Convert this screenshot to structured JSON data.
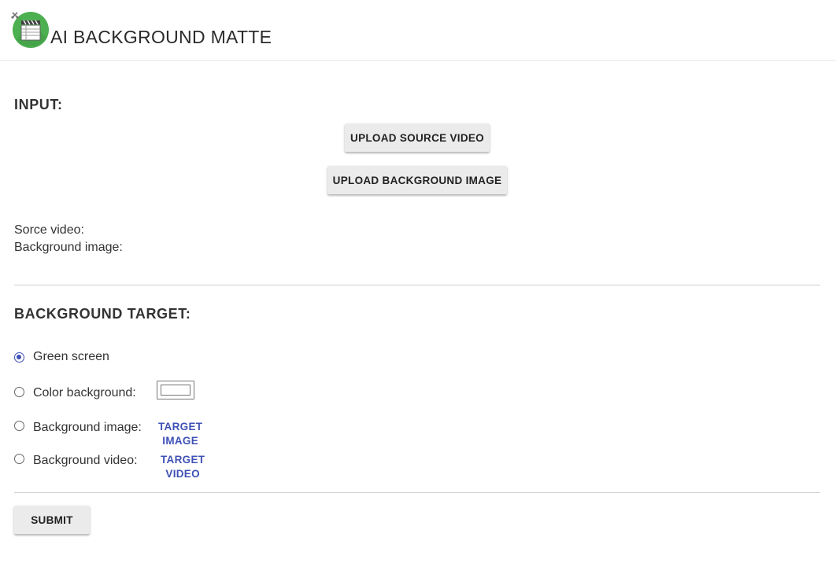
{
  "header": {
    "title": "AI BACKGROUND MATTE",
    "logo_icon": "film-clapperboard-icon"
  },
  "input_section": {
    "title": "INPUT:",
    "upload_source_video_label": "UPLOAD SOURCE VIDEO",
    "upload_background_image_label": "UPLOAD BACKGROUND IMAGE",
    "source_video_label": "Sorce video:",
    "background_image_label": "Background image:"
  },
  "target_section": {
    "title": "BACKGROUND TARGET:",
    "options": [
      {
        "label": "Green screen",
        "checked": true
      },
      {
        "label": "Color background:",
        "checked": false
      },
      {
        "label": "Background image:",
        "checked": false,
        "action_label": "TARGET IMAGE"
      },
      {
        "label": "Background video:",
        "checked": false,
        "action_label": "TARGET VIDEO"
      }
    ],
    "color_value": "#ffffff"
  },
  "submit_label": "SUBMIT",
  "colors": {
    "accent": "#3f51b5",
    "button_bg": "#ebebeb",
    "logo_green": "#4caf50"
  }
}
